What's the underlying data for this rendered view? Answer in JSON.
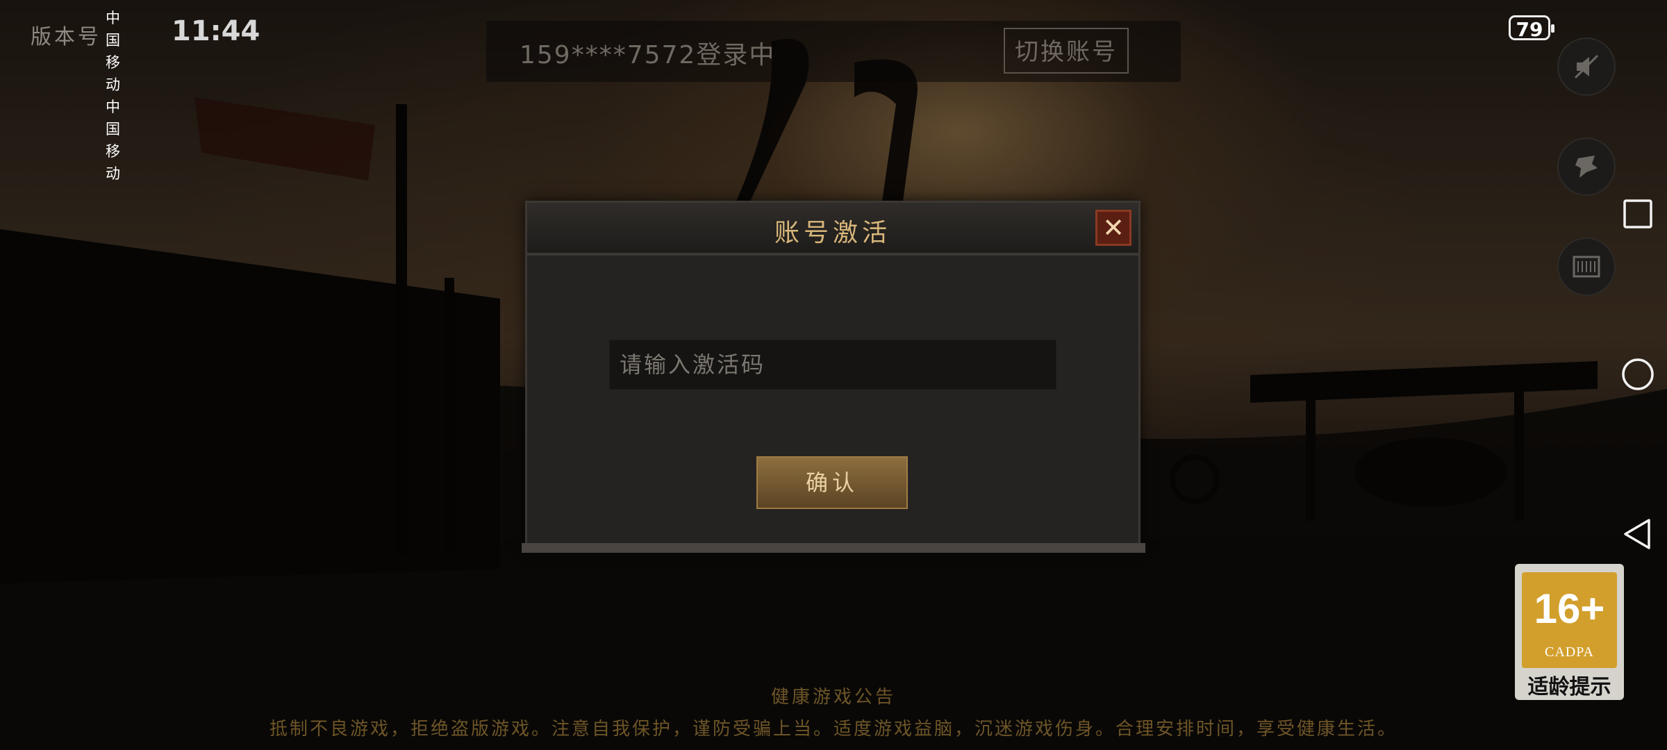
{
  "status_bar": {
    "version_label": "版本号",
    "carrier_1": "中国移动",
    "carrier_2": "中国移动",
    "time": "11:44",
    "battery": "79"
  },
  "login": {
    "account_status": "159****7572登录中",
    "switch_account_label": "切换账号"
  },
  "dialog": {
    "title": "账号激活",
    "close_glyph": "✕",
    "code_placeholder": "请输入激活码",
    "confirm_label": "确认"
  },
  "side_buttons": [
    {
      "icon": "mute-icon"
    },
    {
      "icon": "hero-icon"
    },
    {
      "icon": "scroll-icon"
    }
  ],
  "age_rating": {
    "age": "16+",
    "org": "CADPA",
    "tip": "适龄提示"
  },
  "notice": {
    "title": "健康游戏公告",
    "text": "抵制不良游戏，拒绝盗版游戏。注意自我保护，谨防受骗上当。适度游戏益脑，沉迷游戏伤身。合理安排时间，享受健康生活。"
  },
  "colors": {
    "accent_gold": "#d8b77a",
    "close_red": "#5a1f12",
    "rating_orange": "#d29f2c"
  }
}
